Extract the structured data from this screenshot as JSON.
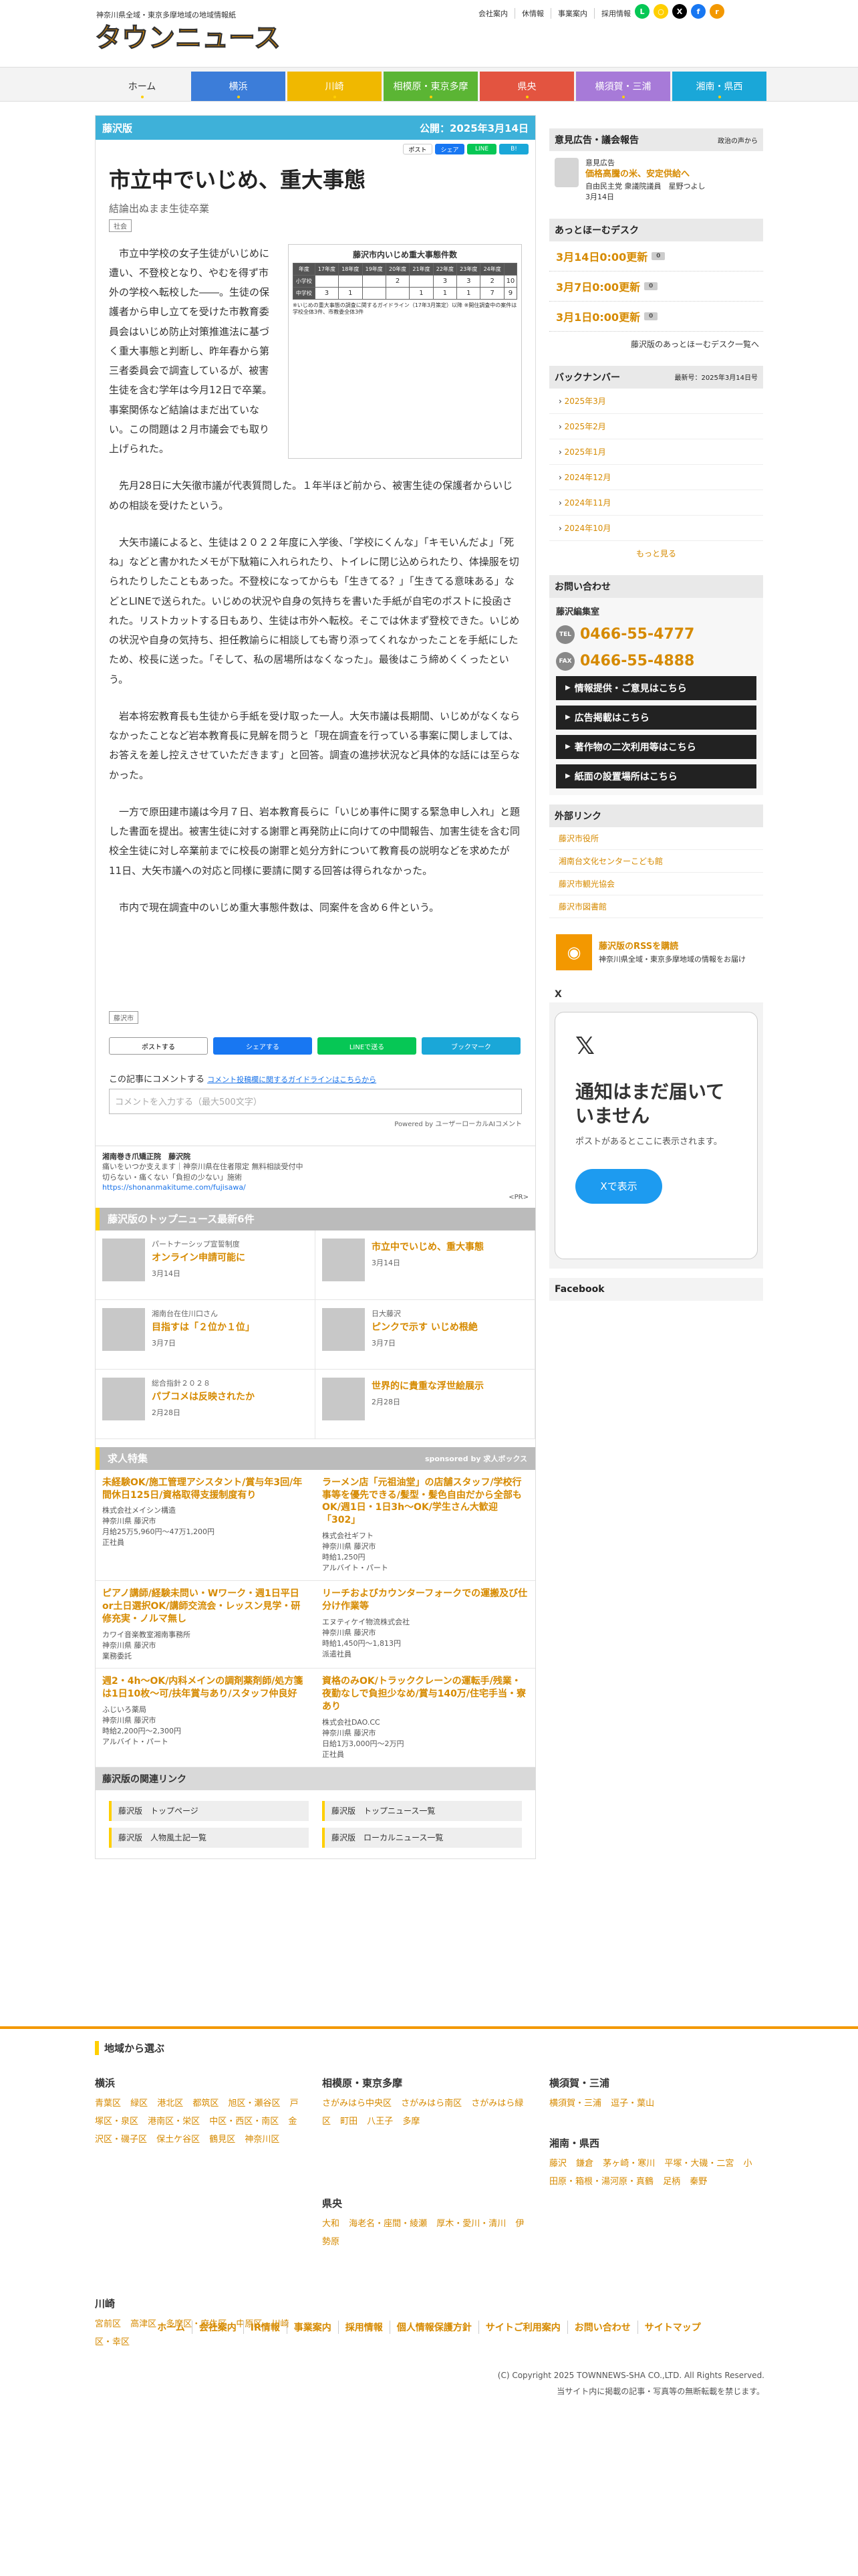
{
  "header": {
    "tagline": "神奈川県全域・東京多摩地域の地域情報紙",
    "logo_text": "タウンニュース",
    "util": [
      "会社案内",
      "休情報",
      "事業案内",
      "採用情報"
    ],
    "sns": [
      {
        "name": "line",
        "color": "#06c755",
        "g": "L"
      },
      {
        "name": "chat",
        "color": "#ffcf00",
        "g": "○"
      },
      {
        "name": "x",
        "color": "#000",
        "g": "X"
      },
      {
        "name": "facebook",
        "color": "#1877f2",
        "g": "f"
      },
      {
        "name": "rss",
        "color": "#f39800",
        "g": "r"
      }
    ]
  },
  "nav": [
    {
      "label": "ホーム",
      "color": "#f3f3f3",
      "text": "#333"
    },
    {
      "label": "横浜",
      "color": "#3c7dd9",
      "text": "#fff"
    },
    {
      "label": "川崎",
      "color": "#f0b800",
      "text": "#fff"
    },
    {
      "label": "相模原・東京多摩",
      "color": "#5bb534",
      "text": "#fff"
    },
    {
      "label": "県央",
      "color": "#e35440",
      "text": "#fff"
    },
    {
      "label": "横須賀・三浦",
      "color": "#a77ad8",
      "text": "#fff"
    },
    {
      "label": "湘南・県西",
      "color": "#1aa7d8",
      "text": "#fff"
    }
  ],
  "article": {
    "region": "藤沢版",
    "published": "公開：2025年3月14日",
    "share_top": [
      "ポスト",
      "シェア",
      "LINE",
      "B!"
    ],
    "title": "市立中でいじめ、重大事態",
    "subtitle": "結論出ぬまま生徒卒業",
    "tag": "社会",
    "lead": "市立中学校の女子生徒がいじめに遭い、不登校となり、やむを得ず市外の学校へ転校した――。生徒の保護者から申し立てを受けた市教育委員会はいじめ防止対策推進法に基づく重大事態と判断し、昨年春から第三者委員会で調査しているが、被害生徒を含む学年は今月12日で卒業。事案関係など結論はまだ出ていない。この問題は２月市議会でも取り上げられた。",
    "table": {
      "title": "藤沢市内いじめ重大事態件数",
      "headers": [
        "年度",
        "17年度",
        "18年度",
        "19年度",
        "20年度",
        "21年度",
        "22年度",
        "23年度",
        "24年度"
      ],
      "rows": [
        [
          "小学校",
          "",
          "",
          "",
          "2",
          "",
          "3",
          "3",
          "2"
        ],
        [
          "中学校",
          "3",
          "1",
          "",
          "",
          "1",
          "1",
          "1",
          "7"
        ]
      ],
      "note": "※いじめの重大事態の調査に関するガイドライン（17年3月策定）以降 ※開住調査中の案件は学校全体3件、市教委全体3件",
      "extra": [
        "10",
        "9"
      ]
    },
    "paragraphs": [
      "先月28日に大矢徹市議が代表質問した。１年半ほど前から、被害生徒の保護者からいじめの相談を受けたという。",
      "大矢市議によると、生徒は２０２２年度に入学後、「学校にくんな」「キモいんだよ」「死ね」などと書かれたメモが下駄箱に入れられたり、トイレに閉じ込められたり、体操服を切られたりしたこともあった。不登校になってからも「生きてる？」「生きてる意味ある」などとLINEで送られた。いじめの状況や自身の気持ちを書いた手紙が自宅のポストに投函された。リストカットする日もあり、生徒は市外へ転校。そこでは休まず登校できた。いじめの状況や自身の気持ち、担任教諭らに相談しても寄り添ってくれなかったことを手紙にしたため、校長に送った。「そして、私の居場所はなくなった」。最後はこう締めくくったという。",
      "岩本将宏教育長も生徒から手紙を受け取った一人。大矢市議は長期間、いじめがなくならなかったことなど岩本教育長に見解を問うと「現在調査を行っている事案に関しましては、お答えを差し控えさせていただきます」と回答。調査の進捗状況など具体的な話には至らなかった。",
      "一方で原田建市議は今月７日、岩本教育長らに「いじめ事件に関する緊急申し入れ」と題した書面を提出。被害生徒に対する謝罪と再発防止に向けての中間報告、加害生徒を含む同校全生徒に対し卒業前までに校長の謝罪と処分方針について教育長の説明などを求めたが11日、大矢市議への対応と同様に要請に関する回答は得られなかった。",
      "市内で現在調査中のいじめ重大事態件数は、同案件を含め６件という。"
    ],
    "bottom_tag": "藤沢市",
    "share_row": [
      "ポストする",
      "シェアする",
      "LINEで送る",
      "ブックマーク"
    ],
    "comment_label": "この記事にコメントする",
    "comment_link": "コメント投稿欄に関するガイドラインはこちらから",
    "comment_placeholder": "コメントを入力する（最大500文字）",
    "powered": "Powered by ユーザーローカルAIコメント"
  },
  "pr": {
    "title": "湘南巻き爪矯正院　藤沢院",
    "lines": [
      "痛いをいつか支えます｜神奈川県在住者限定 無料相談受付中",
      "切らない・痛くない「負担の少ない」施術"
    ],
    "url": "https://shonanmakitume.com/fujisawa/",
    "tag": "<PR>"
  },
  "top_news": {
    "head": "藤沢版のトップニュース最新6件",
    "items": [
      {
        "cat": "パートナーシップ宣誓制度",
        "title": "オンライン申請可能に",
        "date": "3月14日"
      },
      {
        "cat": "",
        "title": "市立中でいじめ、重大事態",
        "date": "3月14日"
      },
      {
        "cat": "湘南台在住川口さん",
        "title": "目指すは「２位か１位」",
        "date": "3月7日"
      },
      {
        "cat": "日大藤沢",
        "title": "ピンクで示す いじめ根絶",
        "date": "3月7日"
      },
      {
        "cat": "総合指針２０２８",
        "title": "パブコメは反映されたか",
        "date": "2月28日"
      },
      {
        "cat": "",
        "title": "世界的に貴重な浮世絵展示",
        "date": "2月28日"
      }
    ]
  },
  "jobs": {
    "head": "求人特集",
    "sponsor": "sponsored by 求人ボックス",
    "items": [
      {
        "title": "未経験OK/施工管理アシスタント/賞与年3回/年間休日125日/資格取得支援制度有り",
        "lines": [
          "株式会社メイシン構造",
          "神奈川県 藤沢市",
          "月給25万5,960円〜47万1,200円",
          "正社員"
        ]
      },
      {
        "title": "ラーメン店「元祖油堂」の店舗スタッフ/学校行事等を優先できる/髪型・髪色自由だから全部もOK/週1日・1日3h〜OK/学生さん大歓迎「302」",
        "lines": [
          "株式会社ギフト",
          "神奈川県 藤沢市",
          "時給1,250円",
          "アルバイト・パート"
        ]
      },
      {
        "title": "ピアノ講師/経験未問い・Wワーク・週1日平日or土日選択OK/講師交流会・レッスン見学・研修充実・ノルマ無し",
        "lines": [
          "カワイ音楽教室湘南事務所",
          "神奈川県 藤沢市",
          "業務委託"
        ]
      },
      {
        "title": "リーチおよびカウンターフォークでの運搬及び仕分け作業等",
        "lines": [
          "エヌティケイ物流株式会社",
          "神奈川県 藤沢市",
          "時給1,450円〜1,813円",
          "派遣社員"
        ]
      },
      {
        "title": "週2・4h〜OK/内科メインの調剤薬剤師/処方箋は1日10枚〜可/扶年賞与あり/スタッフ仲良好",
        "lines": [
          "ふじいろ薬局",
          "神奈川県 藤沢市",
          "時給2,200円〜2,300円",
          "アルバイト・パート"
        ]
      },
      {
        "title": "資格のみOK/トラッククレーンの運転手/残業・夜勤なしで負担少なめ/賞与140万/住宅手当・寮あり",
        "lines": [
          "株式会社DAO.CC",
          "神奈川県 藤沢市",
          "日給1万3,000円〜2万円",
          "正社員"
        ]
      }
    ]
  },
  "related": {
    "head": "藤沢版の関連リンク",
    "items": [
      "藤沢版　トップページ",
      "藤沢版　トップニュース一覧",
      "藤沢版　人物風土記一覧",
      "藤沢版　ローカルニュース一覧"
    ]
  },
  "side": {
    "ad_head": "意見広告・議会報告",
    "ad_mini": "政治の声から",
    "ad_type": "意見広告",
    "ad_title": "価格高騰の米、安定供給へ",
    "ad_author": "自由民主党 衆議院議員　星野つよし",
    "ad_date": "3月14日",
    "desk_head": "あっとほーむデスク",
    "desk": [
      {
        "label": "3月14日0:00更新",
        "c": "0"
      },
      {
        "label": "3月7日0:00更新",
        "c": "0"
      },
      {
        "label": "3月1日0:00更新",
        "c": "0"
      }
    ],
    "desk_more": "藤沢版のあっとほーむデスク一覧へ",
    "bn_head": "バックナンバー",
    "bn_latest": "最新号：2025年3月14日号",
    "bn": [
      "2025年3月",
      "2025年2月",
      "2025年1月",
      "2024年12月",
      "2024年11月",
      "2024年10月"
    ],
    "bn_more": "もっと見る",
    "contact_head": "お問い合わせ",
    "office": "藤沢編集室",
    "tel": "0466-55-4777",
    "fax": "0466-55-4888",
    "buttons": [
      "情報提供・ご意見はこちら",
      "広告掲載はこちら",
      "著作物の二次利用等はこちら",
      "紙面の設置場所はこちら"
    ],
    "ext_head": "外部リンク",
    "ext": [
      "藤沢市役所",
      "湘南台文化センターこども館",
      "藤沢市観光協会",
      "藤沢市図書館"
    ],
    "rss_title": "藤沢版のRSSを購読",
    "rss_desc": "神奈川県全域・東京多摩地域の情報をお届け",
    "x_head": "X",
    "x_heading": "通知はまだ届いていません",
    "x_text": "ポストがあるとここに表示されます。",
    "x_btn": "Xで表示",
    "fb_head": "Facebook"
  },
  "footer": {
    "head": "地域から選ぶ",
    "cols": [
      {
        "h": "横浜",
        "l": [
          "青葉区",
          "緑区",
          "港北区",
          "都筑区",
          "旭区・瀬谷区",
          "戸塚区・泉区",
          "港南区・栄区",
          "中区・西区・南区",
          "金沢区・磯子区",
          "保土ケ谷区",
          "鶴見区",
          "神奈川区"
        ]
      },
      {
        "h": "川崎",
        "l": [
          "宮前区",
          "高津区",
          "多摩区・麻生区",
          "中原区",
          "川崎区・幸区"
        ]
      },
      {
        "h": "相模原・東京多摩",
        "l": [
          "さがみはら中央区",
          "さがみはら南区",
          "さがみはら緑区",
          "町田",
          "八王子",
          "多摩"
        ]
      },
      {
        "h": "県央",
        "l": [
          "大和",
          "海老名・座間・綾瀬",
          "厚木・愛川・清川",
          "伊勢原"
        ]
      },
      {
        "h": "横須賀・三浦",
        "l": [
          "横須賀・三浦",
          "逗子・葉山"
        ]
      },
      {
        "h": "湘南・県西",
        "l": [
          "藤沢",
          "鎌倉",
          "茅ヶ崎・寒川",
          "平塚・大磯・二宮",
          "小田原・箱根・湯河原・真鶴",
          "足柄",
          "秦野"
        ]
      }
    ],
    "links": [
      "ホーム",
      "会社案内",
      "IR情報",
      "事業案内",
      "採用情報",
      "個人情報保護方針",
      "サイトご利用案内",
      "お問い合わせ",
      "サイトマップ"
    ],
    "copy": "(C) Copyright 2025 TOWNNEWS-SHA CO.,LTD. All Rights Reserved.",
    "notice": "当サイト内に掲載の記事・写真等の無断転載を禁じます。"
  }
}
